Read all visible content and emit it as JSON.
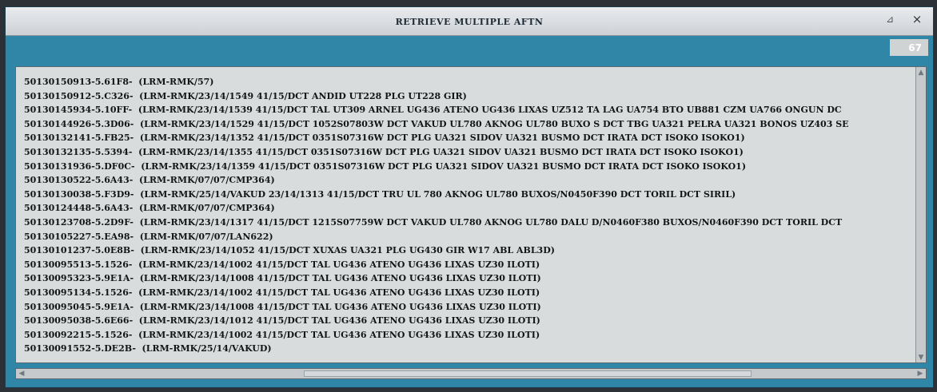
{
  "window": {
    "title": "RETRIEVE MULTIPLE AFTN",
    "restore_icon": "restore-icon",
    "close_icon": "close-icon",
    "restore_glyph": "⊿",
    "close_glyph": "×",
    "count": "67"
  },
  "messages": [
    "50130150913-5.61F8-  (LRM-RMK/57)",
    "50130150912-5.C326-  (LRM-RMK/23/14/1549 41/15/DCT ANDID UT228 PLG UT228 GIR)",
    "50130145934-5.10FF-  (LRM-RMK/23/14/1539 41/15/DCT TAL UT309 ARNEL UG436 ATENO UG436 LIXAS UZ512 TA LAG UA754 BTO UB881 CZM UA766 ONGUN DC",
    "50130144926-5.3D06-  (LRM-RMK/23/14/1529 41/15/DCT 1052S07803W DCT VAKUD UL780 AKNOG UL780 BUXO S DCT TBG UA321 PELRA UA321 BONOS UZ403 SE",
    "50130132141-5.FB25-  (LRM-RMK/23/14/1352 41/15/DCT 0351S07316W DCT PLG UA321 SIDOV UA321 BUSMO DCT IRATA DCT ISOKO ISOKO1)",
    "50130132135-5.5394-  (LRM-RMK/23/14/1355 41/15/DCT 0351S07316W DCT PLG UA321 SIDOV UA321 BUSMO DCT IRATA DCT ISOKO ISOKO1)",
    "50130131936-5.DF0C-  (LRM-RMK/23/14/1359 41/15/DCT 0351S07316W DCT PLG UA321 SIDOV UA321 BUSMO DCT IRATA DCT ISOKO ISOKO1)",
    "50130130522-5.6A43-  (LRM-RMK/07/07/CMP364)",
    "50130130038-5.F3D9-  (LRM-RMK/25/14/VAKUD 23/14/1313 41/15/DCT TRU UL 780 AKNOG UL780 BUXOS/N0450F390 DCT TORIL DCT SIRIL)",
    "50130124448-5.6A43-  (LRM-RMK/07/07/CMP364)",
    "50130123708-5.2D9F-  (LRM-RMK/23/14/1317 41/15/DCT 1215S07759W DCT VAKUD UL780 AKNOG UL780 DALU D/N0460F380 BUXOS/N0460F390 DCT TORIL DCT",
    "50130105227-5.EA98-  (LRM-RMK/07/07/LAN622)",
    "50130101237-5.0E8B-  (LRM-RMK/23/14/1052 41/15/DCT XUXAS UA321 PLG UG430 GIR W17 ABL ABL3D)",
    "50130095513-5.1526-  (LRM-RMK/23/14/1002 41/15/DCT TAL UG436 ATENO UG436 LIXAS UZ30 ILOTI)",
    "50130095323-5.9E1A-  (LRM-RMK/23/14/1008 41/15/DCT TAL UG436 ATENO UG436 LIXAS UZ30 ILOTI)",
    "50130095134-5.1526-  (LRM-RMK/23/14/1002 41/15/DCT TAL UG436 ATENO UG436 LIXAS UZ30 ILOTI)",
    "50130095045-5.9E1A-  (LRM-RMK/23/14/1008 41/15/DCT TAL UG436 ATENO UG436 LIXAS UZ30 ILOTI)",
    "50130095038-5.6E66-  (LRM-RMK/23/14/1012 41/15/DCT TAL UG436 ATENO UG436 LIXAS UZ30 ILOTI)",
    "50130092215-5.1526-  (LRM-RMK/23/14/1002 41/15/DCT TAL UG436 ATENO UG436 LIXAS UZ30 ILOTI)",
    "50130091552-5.DE2B-  (LRM-RMK/25/14/VAKUD)"
  ],
  "scrollbars": {
    "up_icon": "scroll-up-icon",
    "down_icon": "scroll-down-icon",
    "left_icon": "scroll-left-icon",
    "right_icon": "scroll-right-icon",
    "up_glyph": "▲",
    "down_glyph": "▼",
    "left_glyph": "◀",
    "right_glyph": "▶"
  },
  "colors": {
    "window_bg": "#2f86a6",
    "list_bg": "#d8dcdd",
    "text": "#131516"
  }
}
